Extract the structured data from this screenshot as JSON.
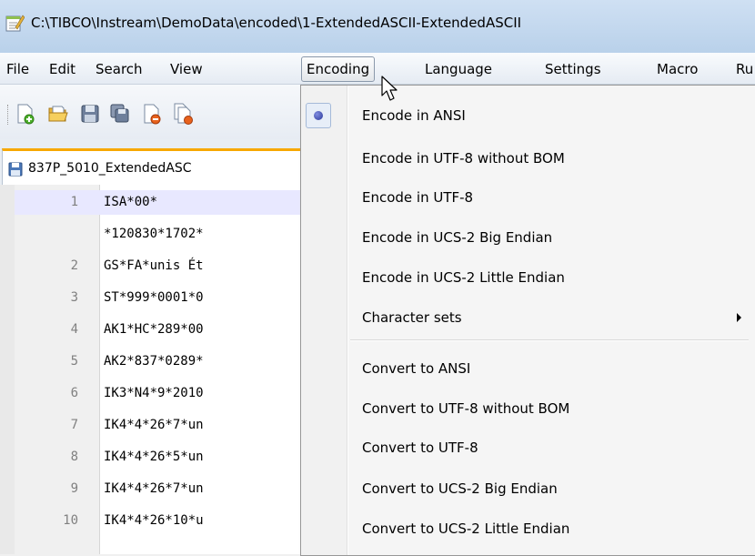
{
  "window": {
    "title": "C:\\TIBCO\\Instream\\DemoData\\encoded\\1-ExtendedASCII-ExtendedASCII"
  },
  "menubar": {
    "items": [
      "File",
      "Edit",
      "Search",
      "View",
      "Encoding",
      "Language",
      "Settings",
      "Macro",
      "Ru"
    ],
    "active": "Encoding"
  },
  "tab": {
    "label": "837P_5010_ExtendedASC"
  },
  "editor": {
    "lines": [
      {
        "num": "1",
        "text": "ISA*00*"
      },
      {
        "num": "",
        "text": "*120830*1702*"
      },
      {
        "num": "2",
        "text": "GS*FA*unis Ét"
      },
      {
        "num": "3",
        "text": "ST*999*0001*0"
      },
      {
        "num": "4",
        "text": "AK1*HC*289*00"
      },
      {
        "num": "5",
        "text": "AK2*837*0289*"
      },
      {
        "num": "6",
        "text": "IK3*N4*9*2010"
      },
      {
        "num": "7",
        "text": "IK4*4*26*7*un"
      },
      {
        "num": "8",
        "text": "IK4*4*26*5*un"
      },
      {
        "num": "9",
        "text": "IK4*4*26*7*un"
      },
      {
        "num": "10",
        "text": "IK4*4*26*10*u"
      }
    ],
    "current_line": "1"
  },
  "encoding_menu": {
    "items": [
      {
        "label": "Encode in ANSI",
        "checked": true
      },
      {
        "label": "Encode in UTF-8 without BOM"
      },
      {
        "label": "Encode in UTF-8"
      },
      {
        "label": "Encode in UCS-2 Big Endian"
      },
      {
        "label": "Encode in UCS-2 Little Endian"
      },
      {
        "label": "Character sets",
        "submenu": true
      },
      {
        "label": "Convert to ANSI"
      },
      {
        "label": "Convert to UTF-8 without BOM"
      },
      {
        "label": "Convert to UTF-8"
      },
      {
        "label": "Convert to UCS-2 Big Endian"
      },
      {
        "label": "Convert to UCS-2 Little Endian"
      }
    ]
  },
  "colors": {
    "tab_accent": "#f7a800",
    "current_line": "#e8e8ff",
    "line_numbers": "#808080",
    "radio_dot": "#2a3799"
  },
  "icons": [
    "notepad-app-icon",
    "new-file-icon",
    "open-file-icon",
    "save-icon",
    "save-all-icon",
    "close-icon",
    "close-all-icon",
    "floppy-tab-icon",
    "submenu-arrow-icon",
    "mouse-cursor-icon",
    "radio-dot-icon"
  ]
}
